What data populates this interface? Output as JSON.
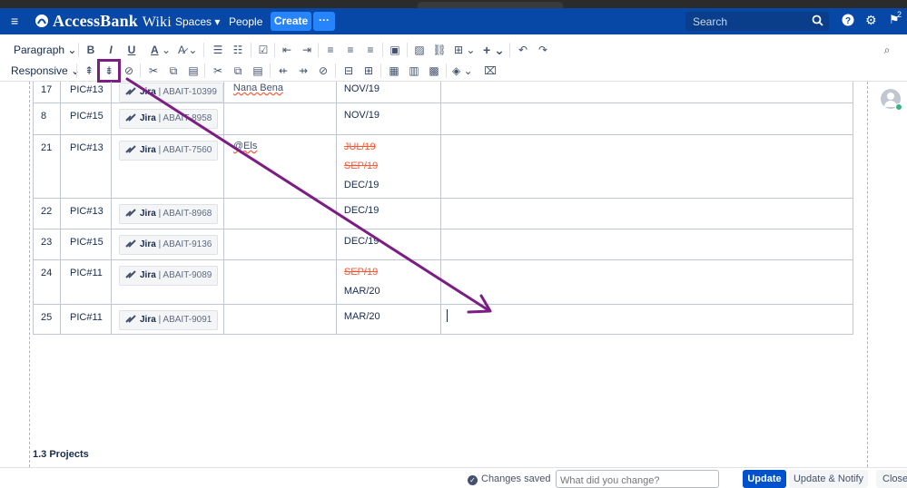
{
  "app": {
    "brand": "AccessBank",
    "brand_suffix": "Wiki",
    "nav": {
      "spaces": "Spaces",
      "people": "People"
    },
    "create_label": "Create",
    "more_label": "···",
    "search_placeholder": "Search",
    "notification_count": "2"
  },
  "toolbar": {
    "paragraph_label": "Paragraph",
    "responsive_label": "Responsive",
    "bold": "B",
    "italic": "I",
    "underline": "U",
    "text_color": "A",
    "plus": "+"
  },
  "table": {
    "rows": [
      {
        "num": "17",
        "pic": "PIC#13",
        "jira_key": "ABAIT-10399",
        "user": "Nana Bena",
        "user_error": true,
        "dates": [
          {
            "text": "NOV/19",
            "strike": false
          }
        ]
      },
      {
        "num": "8",
        "pic": "PIC#15",
        "jira_key": "ABAIT-8958",
        "user": "",
        "user_error": false,
        "dates": [
          {
            "text": "NOV/19",
            "strike": false
          }
        ]
      },
      {
        "num": "21",
        "pic": "PIC#13",
        "jira_key": "ABAIT-7560",
        "user": "@Els",
        "user_error": true,
        "dates": [
          {
            "text": "JUL/19",
            "strike": true
          },
          {
            "text": "SEP/19",
            "strike": true
          },
          {
            "text": "DEC/19",
            "strike": false
          }
        ]
      },
      {
        "num": "22",
        "pic": "PIC#13",
        "jira_key": "ABAIT-8968",
        "user": "",
        "user_error": false,
        "dates": [
          {
            "text": "DEC/19",
            "strike": false
          }
        ]
      },
      {
        "num": "23",
        "pic": "PIC#15",
        "jira_key": "ABAIT-9136",
        "user": "",
        "user_error": false,
        "dates": [
          {
            "text": "DEC/19",
            "strike": false
          }
        ]
      },
      {
        "num": "24",
        "pic": "PIC#11",
        "jira_key": "ABAIT-9089",
        "user": "",
        "user_error": false,
        "dates": [
          {
            "text": "SEP/19",
            "strike": true
          },
          {
            "text": "MAR/20",
            "strike": false
          }
        ]
      },
      {
        "num": "25",
        "pic": "PIC#11",
        "jira_key": "ABAIT-9091",
        "user": "",
        "user_error": false,
        "dates": [
          {
            "text": "MAR/20",
            "strike": false
          }
        ]
      }
    ],
    "jira_label": "Jira"
  },
  "section_title": "1.3 Projects",
  "footer": {
    "saved": "Changes saved",
    "comment_placeholder": "What did you change?",
    "update": "Update",
    "update_notify": "Update & Notify",
    "close": "Close"
  },
  "colors": {
    "topbar": "#0747a6",
    "create": "#2684ff",
    "strike_date": "#ff5630",
    "annotation": "#7b1d83"
  }
}
